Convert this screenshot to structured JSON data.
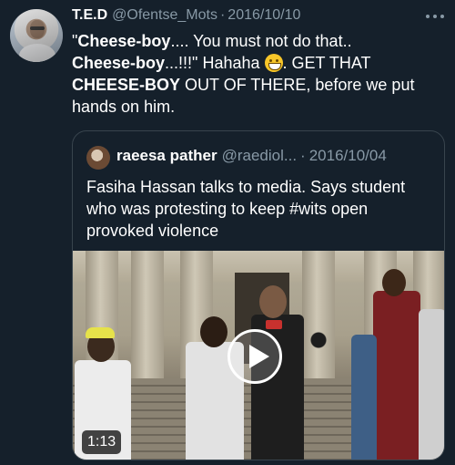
{
  "tweet": {
    "display_name": "T.E.D",
    "handle": "@Ofentse_Mots",
    "separator": "·",
    "date": "2016/10/10",
    "text_parts": {
      "p1": "\"",
      "b1": "Cheese-boy",
      "p2": ".... You must not do that..",
      "b2": "Cheese-boy",
      "p3": "...!!!\" Hahaha ",
      "p4": ". GET THAT ",
      "b3": "CHEESE-BOY",
      "p5": " OUT OF THERE, before we put hands on him."
    },
    "emoji_icon": "grinning-face-emoji",
    "more_icon": "more-options-icon"
  },
  "quoted_tweet": {
    "display_name": "raeesa pather",
    "handle": "@raediol...",
    "separator": "·",
    "date": "2016/10/04",
    "text": "Fasiha Hassan talks to media. Says student who was protesting to keep #wits open provoked violence",
    "media": {
      "type": "video",
      "duration": "1:13",
      "play_icon": "play-icon"
    }
  },
  "colors": {
    "background": "#15202b",
    "secondary_text": "#8899a6",
    "border": "#38444d"
  }
}
